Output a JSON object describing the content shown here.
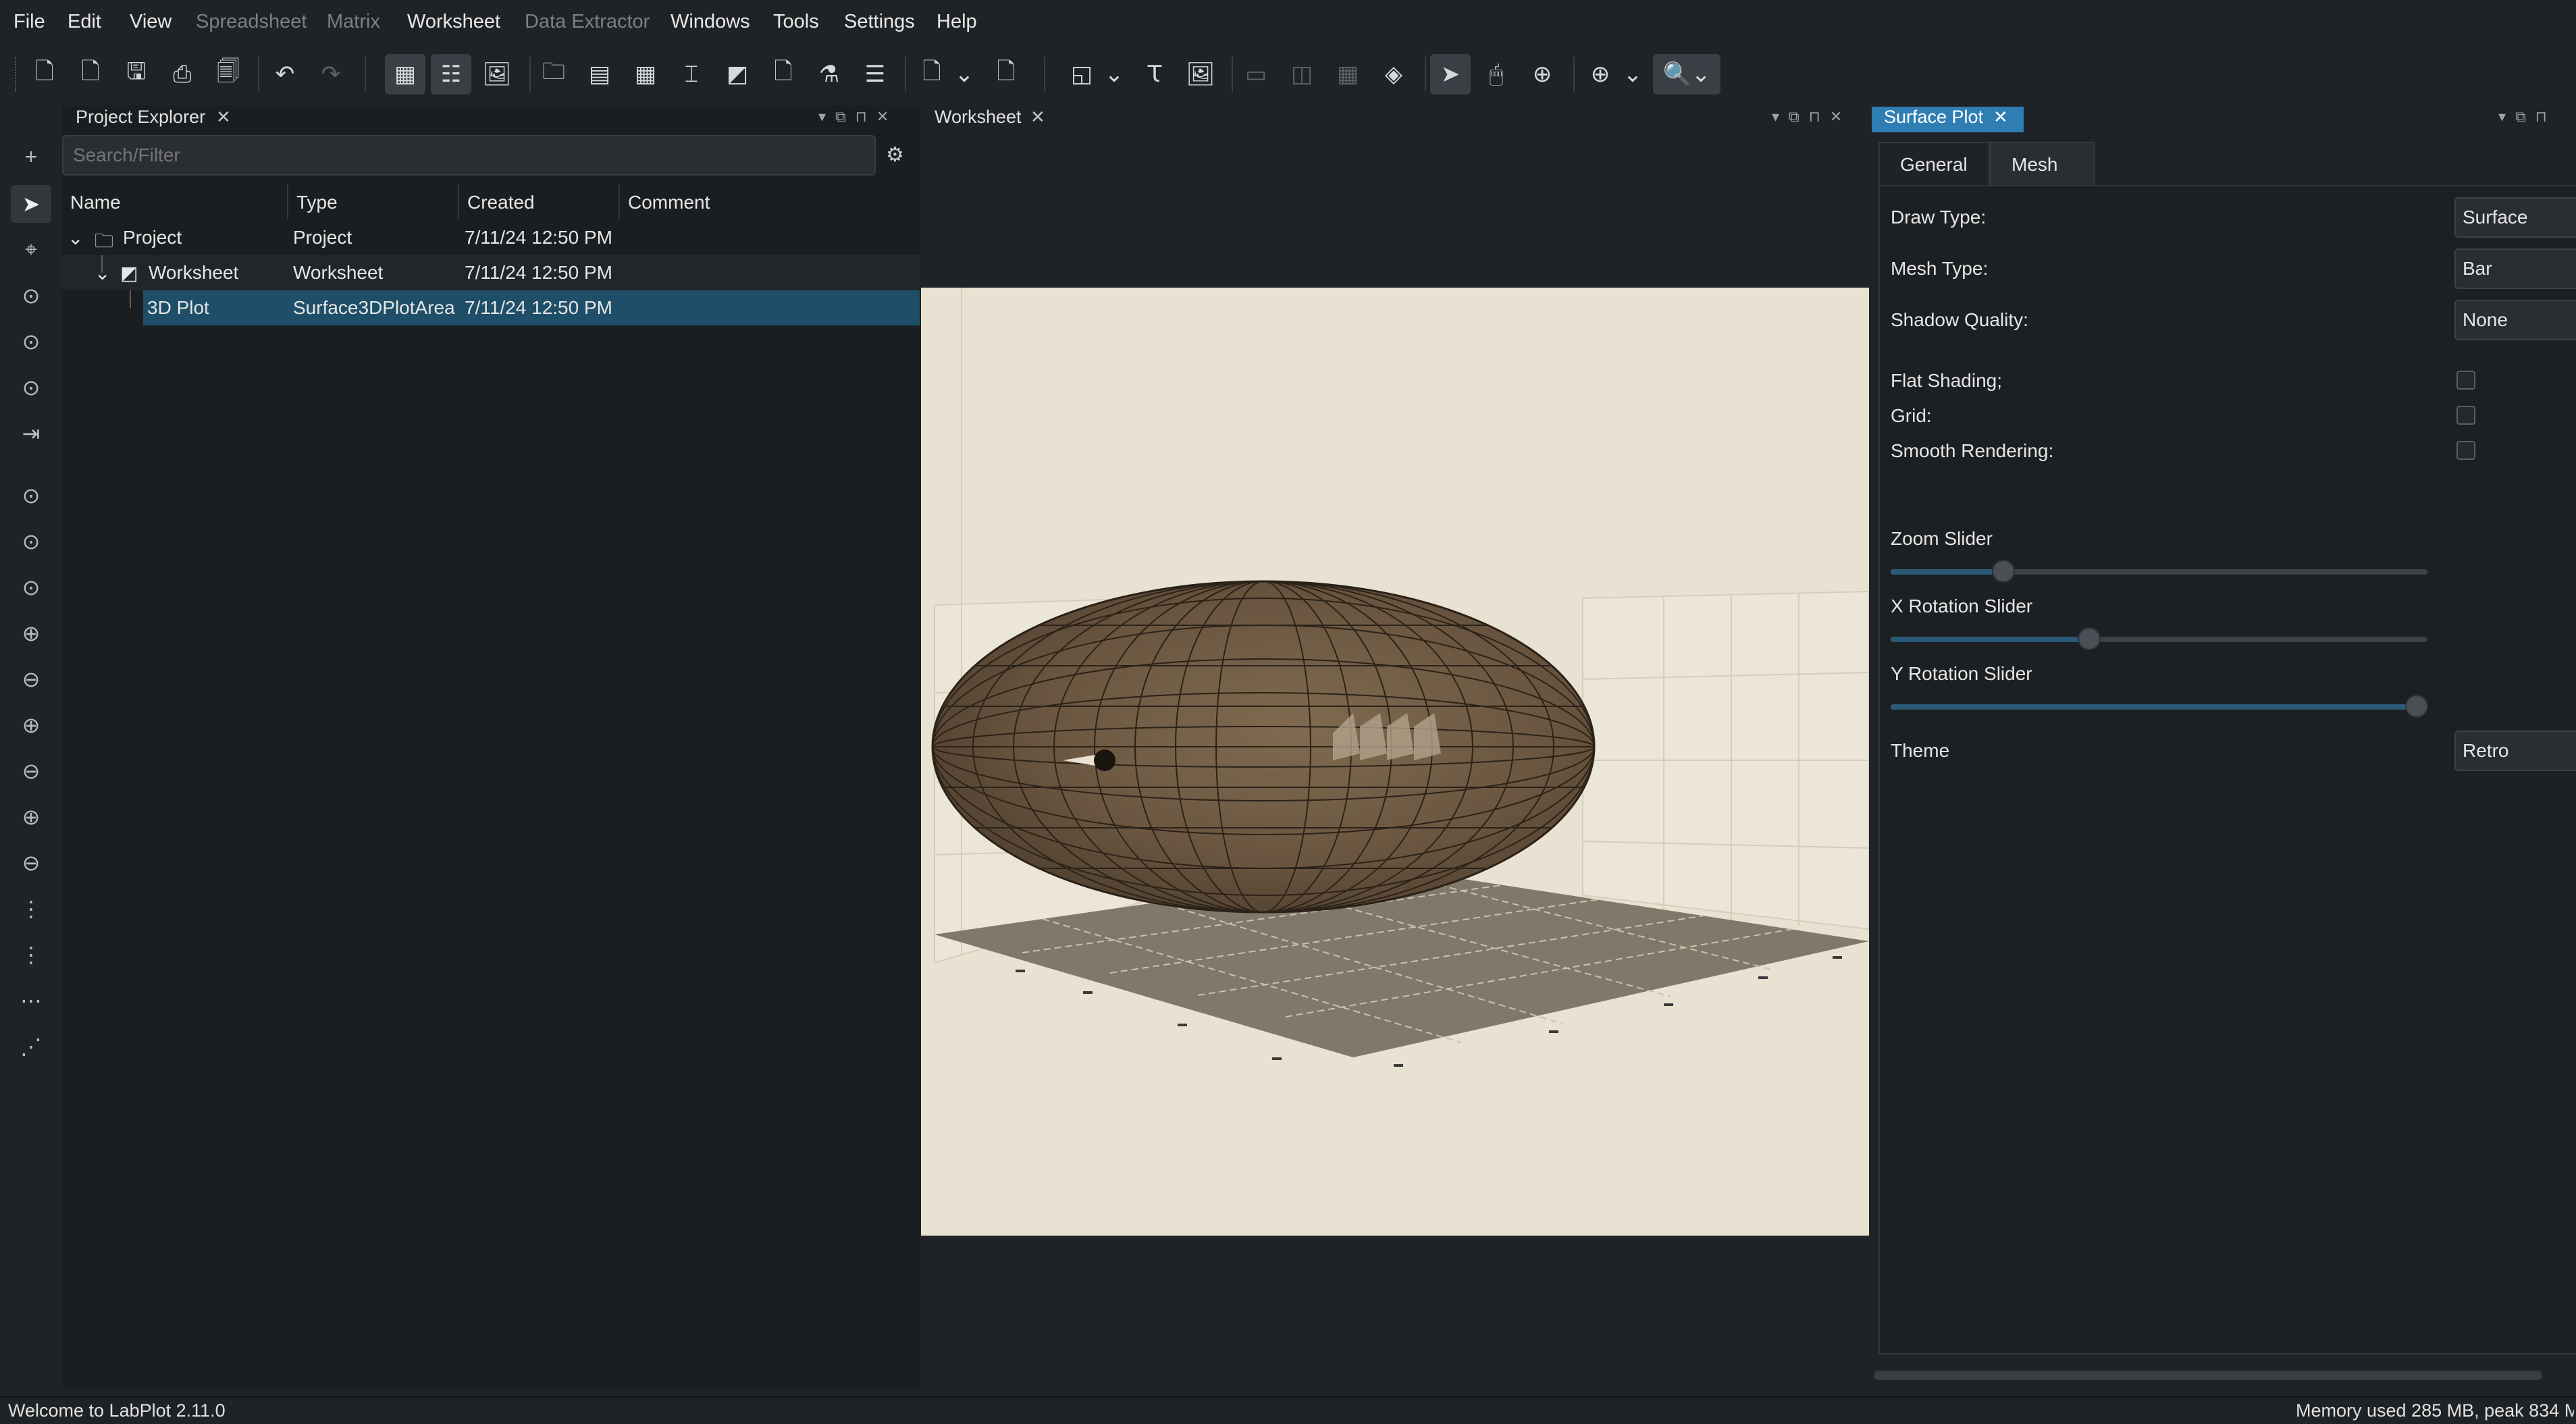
{
  "menubar": {
    "items": [
      {
        "label": "File",
        "enabled": true
      },
      {
        "label": "Edit",
        "enabled": true
      },
      {
        "label": "View",
        "enabled": true
      },
      {
        "label": "Spreadsheet",
        "enabled": false
      },
      {
        "label": "Matrix",
        "enabled": false
      },
      {
        "label": "Worksheet",
        "enabled": true
      },
      {
        "label": "Data Extractor",
        "enabled": false
      },
      {
        "label": "Windows",
        "enabled": true
      },
      {
        "label": "Tools",
        "enabled": true
      },
      {
        "label": "Settings",
        "enabled": true
      },
      {
        "label": "Help",
        "enabled": true
      }
    ]
  },
  "project_explorer": {
    "title": "Project Explorer",
    "search_placeholder": "Search/Filter",
    "columns": [
      "Name",
      "Type",
      "Created",
      "Comment"
    ],
    "rows": [
      {
        "name": "Project",
        "type": "Project",
        "created": "7/11/24 12:50 PM",
        "comment": ""
      },
      {
        "name": "Worksheet",
        "type": "Worksheet",
        "created": "7/11/24 12:50 PM",
        "comment": ""
      },
      {
        "name": "3D Plot",
        "type": "Surface3DPlotArea",
        "created": "7/11/24 12:50 PM",
        "comment": ""
      }
    ]
  },
  "worksheet": {
    "title": "Worksheet"
  },
  "surface_plot": {
    "title": "Surface Plot",
    "tabs": [
      "General",
      "Mesh"
    ],
    "selected_tab": "Mesh",
    "draw_type_label": "Draw Type:",
    "draw_type_value": "Surface",
    "mesh_type_label": "Mesh Type:",
    "mesh_type_value": "Bar",
    "shadow_quality_label": "Shadow Quality:",
    "shadow_quality_value": "None",
    "flat_shading_label": "Flat Shading;",
    "grid_label": "Grid:",
    "smooth_rendering_label": "Smooth Rendering:",
    "zoom_slider_label": "Zoom Slider",
    "zoom_slider_value": 0.21,
    "x_rotation_slider_label": "X Rotation Slider",
    "x_rotation_slider_value": 0.37,
    "y_rotation_slider_label": "Y Rotation Slider",
    "y_rotation_slider_value": 0.98,
    "theme_label": "Theme",
    "theme_value": "Retro"
  },
  "colors": {
    "accent": "#3daee9",
    "selection": "#1e4e68",
    "plot_background": "#e9e2d2",
    "surface": "#6e5a42"
  },
  "statusbar": {
    "left": "Welcome to LabPlot 2.11.0",
    "right": "Memory used 285 MB, peak 834 M"
  }
}
